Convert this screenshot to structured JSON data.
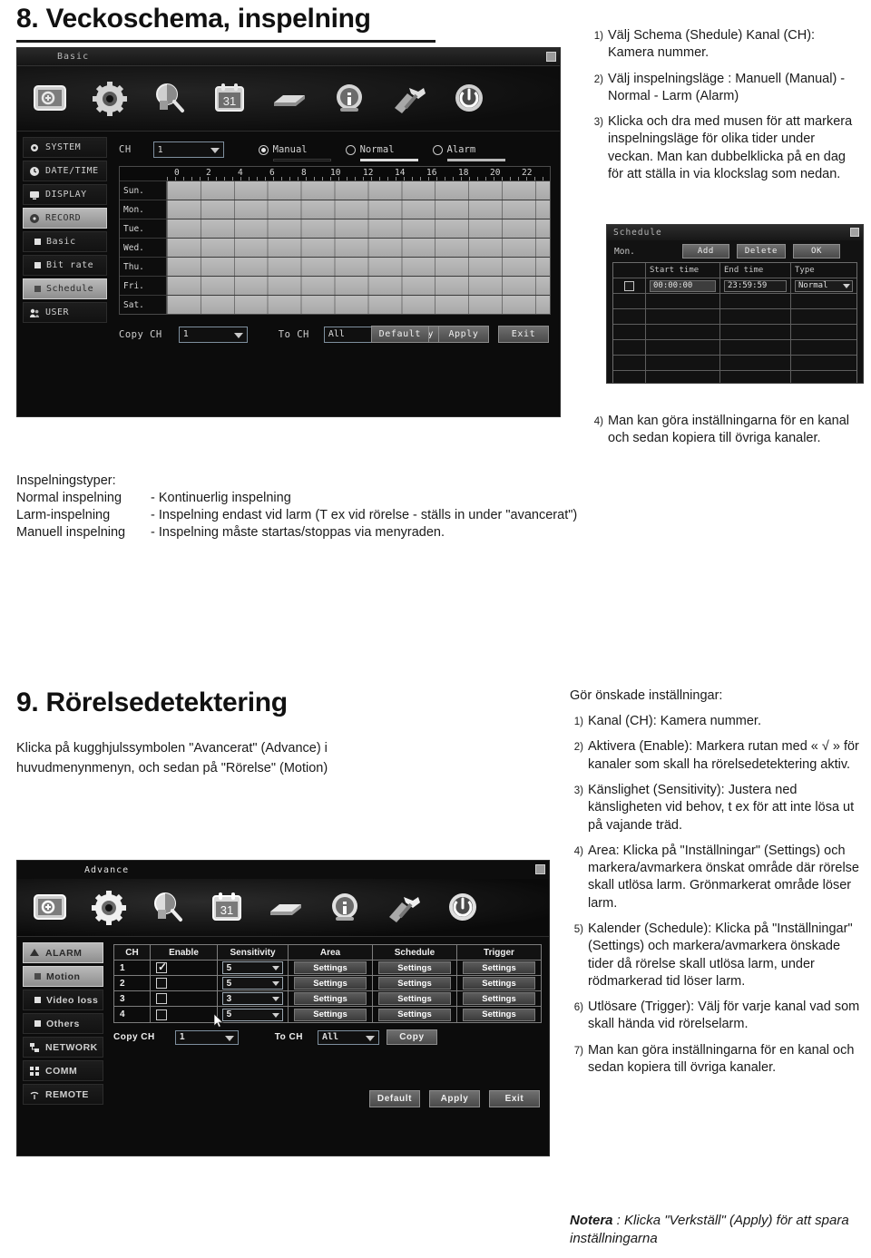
{
  "section8": {
    "heading": "8. Veckoschema, inspelning",
    "steps": [
      {
        "num": "1)",
        "text": "Välj Schema (Shedule) Kanal (CH): Kamera nummer."
      },
      {
        "num": "2)",
        "text": "Välj inspelningsläge : Manuell (Manual) - Normal - Larm (Alarm)"
      },
      {
        "num": "3)",
        "text": "Klicka och dra med musen för att markera inspelningsläge för olika tider under veckan. Man kan dubbelklicka på en dag för att ställa in via klockslag som nedan."
      },
      {
        "num": "4)",
        "text": "Man kan göra inställningarna för en kanal och sedan kopiera till övriga kanaler."
      }
    ],
    "types_heading": "Inspelningstyper:",
    "types": [
      {
        "name": "Normal inspelning",
        "desc": "- Kontinuerlig inspelning"
      },
      {
        "name": "Larm-inspelning",
        "desc": "- Inspelning endast vid larm (T ex vid rörelse - ställs in under \"avancerat\")"
      },
      {
        "name": "Manuell inspelning",
        "desc": "- Inspelning måste startas/stoppas via menyraden."
      }
    ]
  },
  "schedule_window": {
    "title": "Basic",
    "toolbar_icons": [
      "basic-setup-icon",
      "gear-icon",
      "search-icon",
      "calendar-icon",
      "hdd-icon",
      "info-icon",
      "tools-icon",
      "power-icon"
    ],
    "sidebar": [
      {
        "label": "SYSTEM",
        "icon": "gear-icon",
        "selected": false,
        "sub": false
      },
      {
        "label": "DATE/TIME",
        "icon": "clock-icon",
        "selected": false,
        "sub": false
      },
      {
        "label": "DISPLAY",
        "icon": "monitor-icon",
        "selected": false,
        "sub": false
      },
      {
        "label": "RECORD",
        "icon": "disc-icon",
        "selected": true,
        "sub": false
      },
      {
        "label": "Basic",
        "icon": "square-icon",
        "selected": false,
        "sub": true
      },
      {
        "label": "Bit rate",
        "icon": "square-icon",
        "selected": false,
        "sub": true
      },
      {
        "label": "Schedule",
        "icon": "square-icon",
        "selected": true,
        "sub": true
      },
      {
        "label": "USER",
        "icon": "users-icon",
        "selected": false,
        "sub": false
      }
    ],
    "ch_label": "CH",
    "ch_value": "1",
    "modes": [
      {
        "label": "Manual",
        "selected": true,
        "color": "#0a0a0a"
      },
      {
        "label": "Normal",
        "selected": false,
        "color": "#d9d9d9"
      },
      {
        "label": "Alarm",
        "selected": false,
        "color": "#b5b5b5"
      }
    ],
    "hours": [
      "0",
      "2",
      "4",
      "6",
      "8",
      "10",
      "12",
      "14",
      "16",
      "18",
      "20",
      "22"
    ],
    "days": [
      "Sun.",
      "Mon.",
      "Tue.",
      "Wed.",
      "Thu.",
      "Fri.",
      "Sat."
    ],
    "copy_ch_label": "Copy CH",
    "copy_ch_value": "1",
    "to_ch_label": "To CH",
    "to_ch_value": "All",
    "copy_button": "Copy",
    "default_button": "Default",
    "apply_button": "Apply",
    "exit_button": "Exit"
  },
  "schedule_dialog": {
    "title": "Schedule",
    "day": "Mon.",
    "add_button": "Add",
    "delete_button": "Delete",
    "ok_button": "OK",
    "columns": [
      "",
      "Start time",
      "End time",
      "Type"
    ],
    "row": {
      "start": "00:00:00",
      "end": "23:59:59",
      "type": "Normal"
    },
    "empty_rows": 7
  },
  "section9": {
    "heading": "9.   Rörelsedetektering",
    "intro": "Klicka på kugghjulssymbolen \"Avancerat\" (Advance) i huvudmenynmenyn, och sedan på \"Rörelse\" (Motion)",
    "settings_heading": "Gör önskade inställningar:",
    "steps": [
      {
        "num": "1)",
        "text": "Kanal (CH): Kamera nummer."
      },
      {
        "num": "2)",
        "text": "Aktivera (Enable): Markera rutan med « √ » för kanaler som skall ha rörelsedetektering aktiv."
      },
      {
        "num": "3)",
        "text": "Känslighet (Sensitivity): Justera ned känsligheten vid behov, t ex för att inte lösa ut på vajande träd."
      },
      {
        "num": "4)",
        "text": "Area: Klicka på \"Inställningar\" (Settings) och markera/avmarkera önskat område där rörelse skall utlösa larm. Grönmarkerat område löser larm."
      },
      {
        "num": "5)",
        "text": "Kalender (Schedule): Klicka på \"Inställningar\" (Settings) och markera/avmarkera önskade tider då rörelse skall utlösa larm, under rödmarkerad tid löser larm."
      },
      {
        "num": "6)",
        "text": "Utlösare (Trigger): Välj för varje kanal vad som skall hända vid rörelselarm."
      },
      {
        "num": "7)",
        "text": "Man kan göra inställningarna för en kanal och sedan kopiera till övriga kanaler."
      }
    ],
    "note_label": "Notera",
    "note_text": " : Klicka \"Verkställ\" (Apply) för att spara inställningarna"
  },
  "motion_window": {
    "title": "Advance",
    "toolbar_icons": [
      "basic-setup-icon",
      "gear-icon",
      "search-icon",
      "calendar-icon",
      "hdd-icon",
      "info-icon",
      "tools-icon",
      "power-icon"
    ],
    "sidebar": [
      {
        "label": "ALARM",
        "icon": "alarm-icon",
        "selected": true,
        "sub": false
      },
      {
        "label": "Motion",
        "icon": "square-icon",
        "selected": true,
        "sub": true
      },
      {
        "label": "Video loss",
        "icon": "square-icon",
        "selected": false,
        "sub": true
      },
      {
        "label": "Others",
        "icon": "square-icon",
        "selected": false,
        "sub": true
      },
      {
        "label": "NETWORK",
        "icon": "network-icon",
        "selected": false,
        "sub": false
      },
      {
        "label": "COMM",
        "icon": "comm-icon",
        "selected": false,
        "sub": false
      },
      {
        "label": "REMOTE",
        "icon": "remote-icon",
        "selected": false,
        "sub": false
      }
    ],
    "table": {
      "columns": [
        "CH",
        "Enable",
        "Sensitivity",
        "Area",
        "Schedule",
        "Trigger"
      ],
      "rows": [
        {
          "ch": "1",
          "enable": true,
          "sensitivity": "5",
          "area": "Settings",
          "schedule": "Settings",
          "trigger": "Settings"
        },
        {
          "ch": "2",
          "enable": false,
          "sensitivity": "5",
          "area": "Settings",
          "schedule": "Settings",
          "trigger": "Settings"
        },
        {
          "ch": "3",
          "enable": false,
          "sensitivity": "3",
          "area": "Settings",
          "schedule": "Settings",
          "trigger": "Settings"
        },
        {
          "ch": "4",
          "enable": false,
          "sensitivity": "5",
          "area": "Settings",
          "schedule": "Settings",
          "trigger": "Settings"
        }
      ]
    },
    "copy_ch_label": "Copy CH",
    "copy_ch_value": "1",
    "to_ch_label": "To CH",
    "to_ch_value": "All",
    "copy_button": "Copy",
    "default_button": "Default",
    "apply_button": "Apply",
    "exit_button": "Exit"
  }
}
